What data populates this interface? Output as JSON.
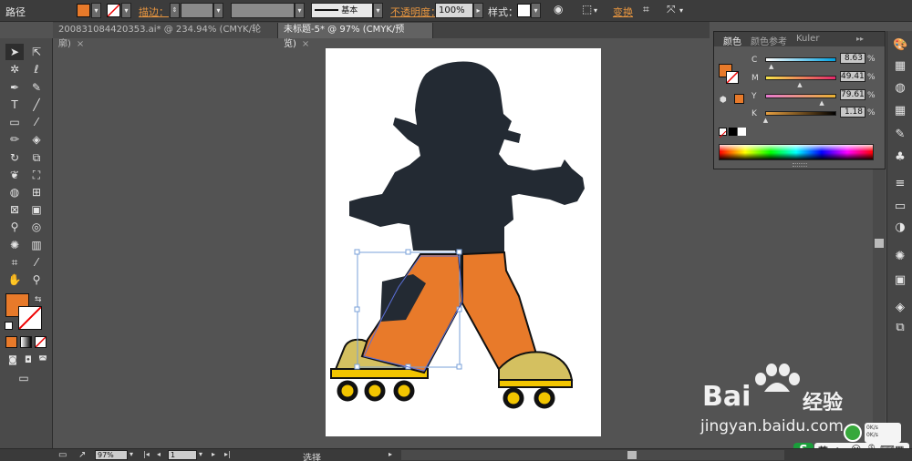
{
  "control_bar": {
    "object_type": "路径",
    "stroke_label": "描边：",
    "opacity_label": "不透明度：",
    "opacity_value": "100%",
    "style_label": "样式：",
    "brush_label": "基本",
    "transform_label": "变换",
    "fill_color": "#e87a2a"
  },
  "tabs": [
    {
      "label": "200831084420353.ai* @ 234.94% (CMYK/轮廓)",
      "close": "×"
    },
    {
      "label": "未标题-5* @ 97% (CMYK/预览)",
      "close": "×"
    }
  ],
  "color_panel": {
    "tabs": [
      "颜色",
      "颜色参考",
      "Kuler"
    ],
    "menu": "▸▸",
    "channels": [
      {
        "name": "C",
        "value": "8.63",
        "unit": "%",
        "fraction": 0.09,
        "gradient": "linear-gradient(90deg,#ffffff,#00a0e0)"
      },
      {
        "name": "M",
        "value": "49.41",
        "unit": "%",
        "fraction": 0.49,
        "gradient": "linear-gradient(90deg,#f7e54a,#e2266a)"
      },
      {
        "name": "Y",
        "value": "79.61",
        "unit": "%",
        "fraction": 0.8,
        "gradient": "linear-gradient(90deg,#e87ad0,#e8b030)"
      },
      {
        "name": "K",
        "value": "1.18",
        "unit": "%",
        "fraction": 0.01,
        "gradient": "linear-gradient(90deg,#e8a040,#000000)"
      }
    ]
  },
  "status_bar": {
    "zoom": "97%",
    "page": "1",
    "tool": "选择"
  },
  "watermark": {
    "brand": "Bai",
    "brand_tail": "经验",
    "url": "jingyan.baidu.com"
  },
  "tray": {
    "ime": "英",
    "net_up": "0K/s",
    "net_down": "0K/s"
  },
  "colors": {
    "silhouette": "#232a33",
    "pants": "#e87a2a",
    "shoe": "#d4c060",
    "wheel": "#f2c500"
  }
}
